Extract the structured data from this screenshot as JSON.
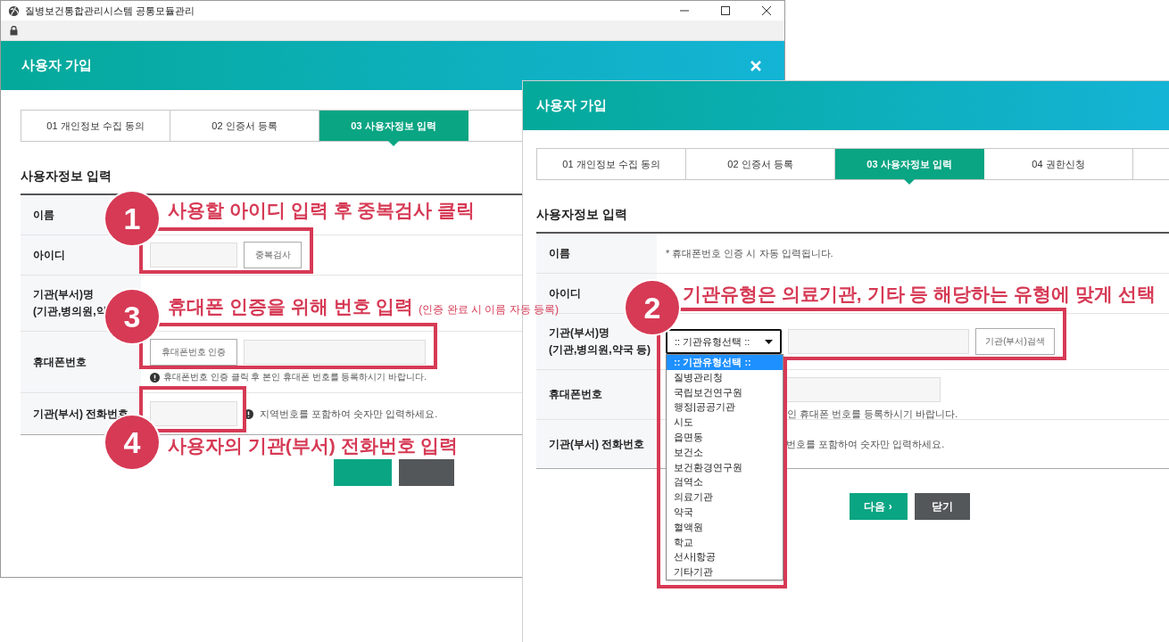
{
  "windows": [
    {
      "browser_title": "질병보건통합관리시스템 공통모듈관리",
      "header_title": "사용자 가입",
      "tabs": [
        {
          "label": "01 개인정보 수집 동의",
          "selected": false
        },
        {
          "label": "02 인증서 등록",
          "selected": false
        },
        {
          "label": "03 사용자정보 입력",
          "selected": true
        }
      ],
      "section_title": "사용자정보 입력",
      "rows": [
        {
          "kind": "text",
          "label": "이름"
        },
        {
          "kind": "id",
          "label": "아이디",
          "button": "중복검사"
        },
        {
          "kind": "org",
          "label": "기관(부서)명",
          "sublabel": "(기관,병의원,약"
        },
        {
          "kind": "phone",
          "label": "휴대폰번호",
          "button": "휴대폰번호 인증",
          "hint": "휴대폰번호 인증 클릭 후 본인 휴대폰 번호를 등록하시기 바랍니다.",
          "info_icon": true
        },
        {
          "kind": "tel",
          "label": "기관(부서) 전화번호",
          "hint": "지역번호를 포함하여 숫자만 입력하세요.",
          "info_icon": true
        }
      ],
      "buttons": [
        {
          "kind": "next"
        },
        {
          "kind": "close"
        }
      ]
    },
    {
      "header_title": "사용자 가입",
      "tabs": [
        {
          "label": "01 개인정보 수집 동의",
          "selected": false
        },
        {
          "label": "02 인증서 등록",
          "selected": false
        },
        {
          "label": "03 사용자정보 입력",
          "selected": true
        },
        {
          "label": "04 권한신청",
          "selected": false
        }
      ],
      "section_title": "사용자정보 입력",
      "rows": [
        {
          "kind": "text",
          "label": "이름",
          "text": "* 휴대폰번호 인증 시 자동 입력됩니다."
        },
        {
          "kind": "id",
          "label": "아이디"
        },
        {
          "kind": "org",
          "label": "기관(부서)명",
          "sublabel": "(기관,병의원,약국 등)",
          "select": ":: 기관유형선택 ::",
          "button": "기관(부서)검색",
          "options": [
            {
              "label": ":: 기관유형선택 ::",
              "selected": true
            },
            {
              "label": "질병관리청",
              "selected": false
            },
            {
              "label": "국립보건연구원",
              "selected": false
            },
            {
              "label": "행정|공공기관",
              "selected": false
            },
            {
              "label": "시도",
              "selected": false
            },
            {
              "label": "읍면동",
              "selected": false
            },
            {
              "label": "보건소",
              "selected": false
            },
            {
              "label": "보건환경연구원",
              "selected": false
            },
            {
              "label": "검역소",
              "selected": false
            },
            {
              "label": "의료기관",
              "selected": false
            },
            {
              "label": "약국",
              "selected": false
            },
            {
              "label": "혈액원",
              "selected": false
            },
            {
              "label": "학교",
              "selected": false
            },
            {
              "label": "선사|항공",
              "selected": false
            },
            {
              "label": "기타기관",
              "selected": false
            }
          ]
        },
        {
          "kind": "phone",
          "label": "휴대폰번호",
          "hint": "인 휴대폰 번호를 등록하시기 바랍니다."
        },
        {
          "kind": "tel",
          "label": "기관(부서) 전화번호",
          "hint": "번호를 포함하여 숫자만 입력하세요."
        }
      ],
      "buttons": [
        {
          "kind": "next",
          "label": "다음 ›"
        },
        {
          "kind": "close",
          "label": "닫기"
        }
      ]
    }
  ],
  "annotations": [
    {
      "number": "1",
      "text": "사용할 아이디 입력 후 중복검사 클릭"
    },
    {
      "number": "3",
      "text": "휴대폰 인증을 위해 번호 입력",
      "note": "(인증 완료 시 이름 자동 등록)"
    },
    {
      "number": "4",
      "text": "사용자의 기관(부서) 전화번호 입력"
    },
    {
      "number": "2",
      "text": "기관유형은 의료기관, 기타 등 해당하는 유형에 맞게 선택"
    }
  ]
}
